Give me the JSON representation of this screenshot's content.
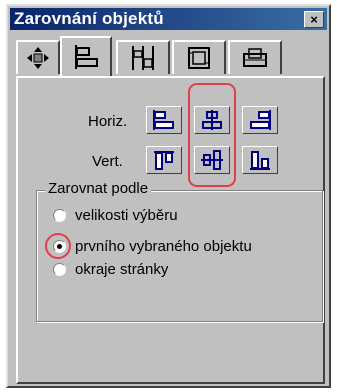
{
  "window": {
    "title": "Zarovnání objektů",
    "close_label": "×"
  },
  "tabs": [
    {
      "icon": "move-icon",
      "active": false
    },
    {
      "icon": "align-left-icon",
      "active": true
    },
    {
      "icon": "distribute-icon",
      "active": false
    },
    {
      "icon": "frame-icon",
      "active": false
    },
    {
      "icon": "group-icon",
      "active": false
    }
  ],
  "align": {
    "horiz_label": "Horiz.",
    "vert_label": "Vert.",
    "horiz_buttons": [
      "align-left-icon",
      "align-center-horizontal-icon",
      "align-right-icon"
    ],
    "vert_buttons": [
      "align-top-icon",
      "align-middle-vertical-icon",
      "align-bottom-icon"
    ]
  },
  "align_by": {
    "title": "Zarovnat podle",
    "options": [
      {
        "label": "velikosti výběru",
        "selected": false
      },
      {
        "label": "prvního vybraného objektu",
        "selected": true
      },
      {
        "label": "okraje stránky",
        "selected": false
      }
    ]
  },
  "colors": {
    "highlight": "#e0404a",
    "title_bar": "#0a246a",
    "icon": "#000080"
  }
}
